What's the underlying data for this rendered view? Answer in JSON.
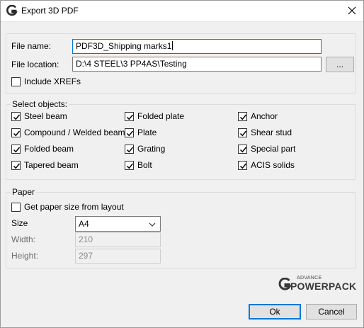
{
  "window": {
    "title": "Export 3D PDF",
    "accent_color": "#0078d7"
  },
  "file": {
    "name_label": "File name:",
    "name_value": "PDF3D_Shipping marks1",
    "location_label": "File location:",
    "location_value": "D:\\4 STEEL\\3 PP4AS\\Testing",
    "browse_label": "...",
    "include_xrefs_label": "Include XREFs",
    "include_xrefs_checked": false
  },
  "objects": {
    "group_title": "Select objects:",
    "items": [
      {
        "label": "Steel beam",
        "checked": true
      },
      {
        "label": "Compound / Welded beam",
        "checked": true
      },
      {
        "label": "Folded beam",
        "checked": true
      },
      {
        "label": "Tapered beam",
        "checked": true
      },
      {
        "label": "Folded plate",
        "checked": true
      },
      {
        "label": "Plate",
        "checked": true
      },
      {
        "label": "Grating",
        "checked": true
      },
      {
        "label": "Bolt",
        "checked": true
      },
      {
        "label": "Anchor",
        "checked": true
      },
      {
        "label": "Shear stud",
        "checked": true
      },
      {
        "label": "Special part",
        "checked": true
      },
      {
        "label": "ACIS solids",
        "checked": true
      }
    ]
  },
  "paper": {
    "group_title": "Paper",
    "get_from_layout_label": "Get paper size from layout",
    "get_from_layout_checked": false,
    "size_label": "Size",
    "size_value": "A4",
    "width_label": "Width:",
    "width_value": "210",
    "height_label": "Height:",
    "height_value": "297"
  },
  "logo": {
    "small_text": "ADVANCE",
    "big_text": "POWERPACK"
  },
  "buttons": {
    "ok_label": "Ok",
    "cancel_label": "Cancel"
  }
}
